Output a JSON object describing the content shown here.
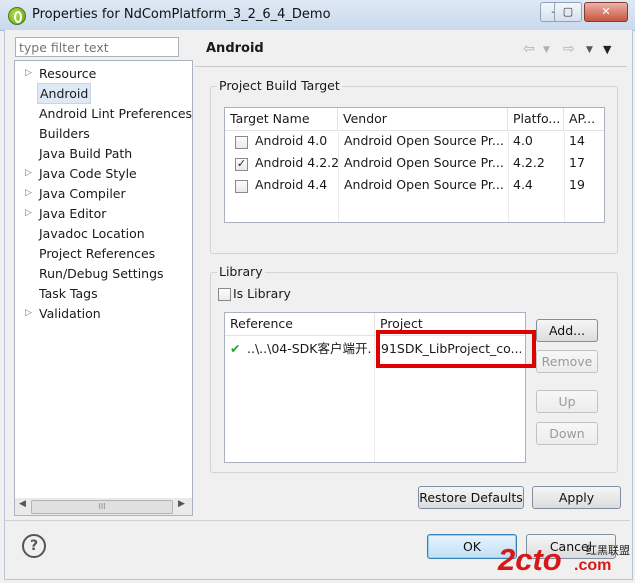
{
  "window": {
    "title": "Properties for NdComPlatform_3_2_6_4_Demo",
    "minimize": "–",
    "maximize": "▢",
    "close": "✕"
  },
  "filter": {
    "placeholder": "type filter text"
  },
  "tree": {
    "items": [
      {
        "label": "Resource",
        "expandable": true
      },
      {
        "label": "Android",
        "selected": true
      },
      {
        "label": "Android Lint Preferences"
      },
      {
        "label": "Builders"
      },
      {
        "label": "Java Build Path"
      },
      {
        "label": "Java Code Style",
        "expandable": true
      },
      {
        "label": "Java Compiler",
        "expandable": true
      },
      {
        "label": "Java Editor",
        "expandable": true
      },
      {
        "label": "Javadoc Location"
      },
      {
        "label": "Project References"
      },
      {
        "label": "Run/Debug Settings"
      },
      {
        "label": "Task Tags"
      },
      {
        "label": "Validation",
        "expandable": true
      }
    ],
    "scroll_thumb": "III"
  },
  "page": {
    "title": "Android",
    "build_target": {
      "group_label": "Project Build Target",
      "columns": [
        "Target Name",
        "Vendor",
        "Platfo...",
        "AP..."
      ],
      "rows": [
        {
          "checked": false,
          "name": "Android 4.0",
          "vendor": "Android Open Source Pr...",
          "platform": "4.0",
          "api": "14"
        },
        {
          "checked": true,
          "name": "Android 4.2.2",
          "vendor": "Android Open Source Pr...",
          "platform": "4.2.2",
          "api": "17"
        },
        {
          "checked": false,
          "name": "Android 4.4",
          "vendor": "Android Open Source Pr...",
          "platform": "4.4",
          "api": "19"
        }
      ]
    },
    "library": {
      "group_label": "Library",
      "is_library_label": "Is Library",
      "is_library_checked": false,
      "columns": [
        "Reference",
        "Project"
      ],
      "rows": [
        {
          "status": "✔",
          "reference": "..\\..\\04-SDK客户端开...",
          "project": "91SDK_LibProject_co..."
        }
      ],
      "buttons": {
        "add": "Add...",
        "remove": "Remove",
        "up": "Up",
        "down": "Down"
      }
    },
    "restore_defaults": "Restore Defaults",
    "apply": "Apply"
  },
  "footer": {
    "help": "?",
    "ok": "OK",
    "cancel": "Cancel"
  },
  "watermark": {
    "logo": "2cto",
    "suffix": ".com",
    "tag": "红黑联盟"
  },
  "colors": {
    "highlight": "#e00000",
    "check": "#2ea52e"
  }
}
